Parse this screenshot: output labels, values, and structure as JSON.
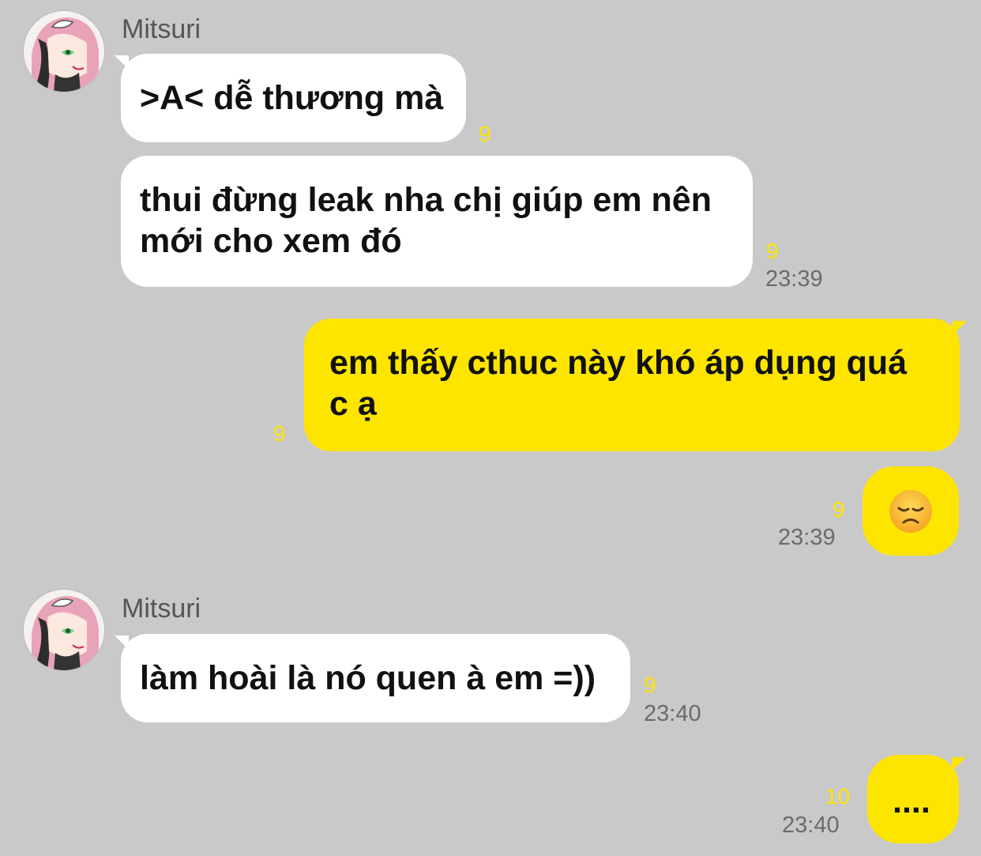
{
  "colors": {
    "background": "#c9c9c9",
    "incoming_bubble": "#ffffff",
    "outgoing_bubble": "#fee500",
    "unread_count": "#fee500",
    "time": "#6b6b6b"
  },
  "messages": {
    "group1": {
      "sender": "Mitsuri",
      "avatar": "anime-avatar-icon",
      "m1": {
        "text": ">A< dễ thương mà",
        "unread": "9"
      },
      "m2": {
        "text": "thui đừng leak nha chị giúp em nên mới cho xem đó",
        "unread": "9",
        "time": "23:39"
      }
    },
    "out1": {
      "text": "em thấy cthuc này khó áp dụng quá c ạ",
      "unread": "9"
    },
    "out2": {
      "emoji": "disappointed-face-icon",
      "unread": "9",
      "time": "23:39"
    },
    "group2": {
      "sender": "Mitsuri",
      "avatar": "anime-avatar-icon",
      "m1": {
        "text": "làm hoài là nó quen à em =))",
        "unread": "9",
        "time": "23:40"
      }
    },
    "out3": {
      "text": "....",
      "unread": "10",
      "time": "23:40"
    }
  }
}
